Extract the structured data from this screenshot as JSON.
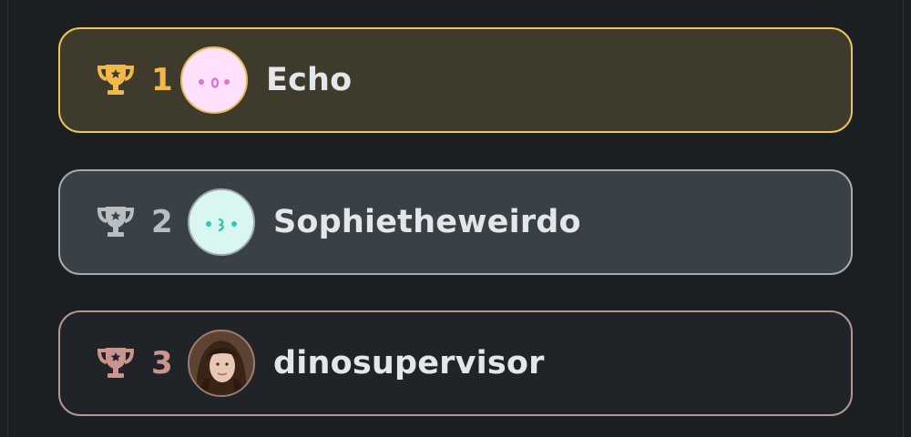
{
  "leaderboard": {
    "entries": [
      {
        "rank": "1",
        "name": "Echo",
        "tier": "gold",
        "trophy_color": "#f2b94a",
        "avatar_face": "• o •",
        "avatar_face_color": "#e36fd9",
        "avatar_bg": "#ffe1fb",
        "icon": "trophy-icon"
      },
      {
        "rank": "2",
        "name": "Sophietheweirdo",
        "tier": "silver",
        "trophy_color": "#b9bec2",
        "avatar_face": "• з •",
        "avatar_face_color": "#2fc8b5",
        "avatar_bg": "#d9f6f0",
        "icon": "trophy-icon"
      },
      {
        "rank": "3",
        "name": "dinosupervisor",
        "tier": "bronze",
        "trophy_color": "#c9958c",
        "avatar_type": "photo",
        "icon": "trophy-icon"
      }
    ]
  }
}
